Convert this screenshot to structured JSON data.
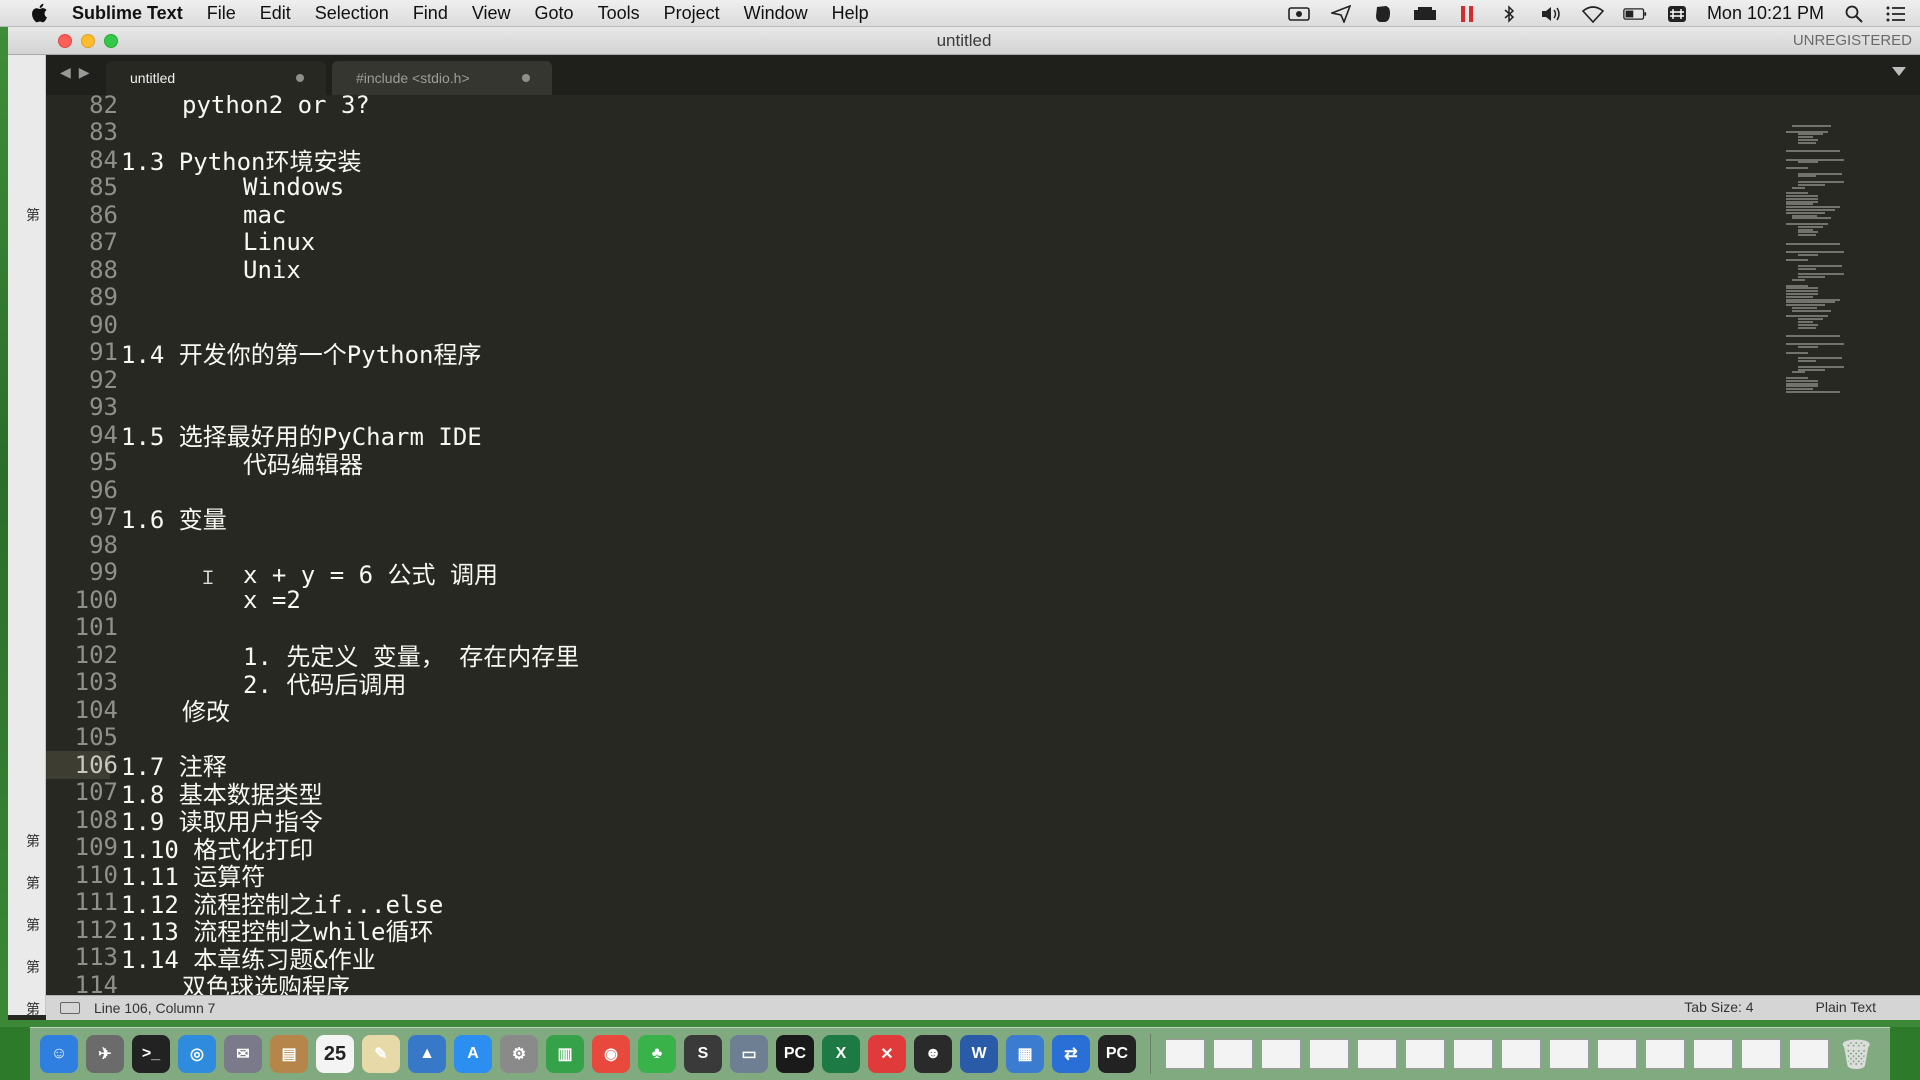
{
  "menubar": {
    "app_name": "Sublime Text",
    "items": [
      "File",
      "Edit",
      "Selection",
      "Find",
      "View",
      "Goto",
      "Tools",
      "Project",
      "Window",
      "Help"
    ],
    "clock": "Mon 10:21 PM",
    "status_icons": [
      "screen-record-icon",
      "send-icon",
      "evernote-icon",
      "drive-icon",
      "pause-icon",
      "bluetooth-icon",
      "volume-icon",
      "wifi-icon",
      "battery-icon",
      "input-method-icon",
      "spotlight-icon",
      "notification-center-icon"
    ]
  },
  "window": {
    "title": "untitled",
    "license": "UNREGISTERED"
  },
  "tabs": [
    {
      "label": "untitled",
      "active": true
    },
    {
      "label": "#include <stdio.h>",
      "active": false
    }
  ],
  "editor": {
    "current_line": 106,
    "lines": [
      {
        "n": "82",
        "indent": 2,
        "text": "python2 or 3?"
      },
      {
        "n": "83",
        "indent": 0,
        "text": ""
      },
      {
        "n": "84",
        "indent": 0,
        "text": "1.3 Python环境安装"
      },
      {
        "n": "85",
        "indent": 4,
        "text": "Windows"
      },
      {
        "n": "86",
        "indent": 4,
        "text": "mac"
      },
      {
        "n": "87",
        "indent": 4,
        "text": "Linux"
      },
      {
        "n": "88",
        "indent": 4,
        "text": "Unix"
      },
      {
        "n": "89",
        "indent": 0,
        "text": ""
      },
      {
        "n": "90",
        "indent": 0,
        "text": ""
      },
      {
        "n": "91",
        "indent": 0,
        "text": "1.4 开发你的第一个Python程序"
      },
      {
        "n": "92",
        "indent": 0,
        "text": ""
      },
      {
        "n": "93",
        "indent": 0,
        "text": ""
      },
      {
        "n": "94",
        "indent": 0,
        "text": "1.5 选择最好用的PyCharm IDE"
      },
      {
        "n": "95",
        "indent": 4,
        "text": "代码编辑器"
      },
      {
        "n": "96",
        "indent": 0,
        "text": ""
      },
      {
        "n": "97",
        "indent": 0,
        "text": "1.6 变量"
      },
      {
        "n": "98",
        "indent": 0,
        "text": ""
      },
      {
        "n": "99",
        "indent": 4,
        "text": "x + y = 6 公式 调用"
      },
      {
        "n": "100",
        "indent": 4,
        "text": "x =2"
      },
      {
        "n": "101",
        "indent": 0,
        "text": ""
      },
      {
        "n": "102",
        "indent": 4,
        "text": "1. 先定义 变量， 存在内存里"
      },
      {
        "n": "103",
        "indent": 4,
        "text": "2. 代码后调用"
      },
      {
        "n": "104",
        "indent": 2,
        "text": "修改"
      },
      {
        "n": "105",
        "indent": 0,
        "text": ""
      },
      {
        "n": "106",
        "indent": 0,
        "text": "1.7 注释"
      },
      {
        "n": "107",
        "indent": 0,
        "text": "1.8 基本数据类型"
      },
      {
        "n": "108",
        "indent": 0,
        "text": "1.9 读取用户指令"
      },
      {
        "n": "109",
        "indent": 0,
        "text": "1.10 格式化打印"
      },
      {
        "n": "110",
        "indent": 0,
        "text": "1.11 运算符"
      },
      {
        "n": "111",
        "indent": 0,
        "text": "1.12 流程控制之if...else"
      },
      {
        "n": "112",
        "indent": 0,
        "text": "1.13 流程控制之while循环"
      },
      {
        "n": "113",
        "indent": 0,
        "text": "1.14 本章练习题&作业"
      },
      {
        "n": "114",
        "indent": 2,
        "text": "双色球选购程序"
      }
    ]
  },
  "status": {
    "position": "Line 106, Column 7",
    "tab_size": "Tab Size: 4",
    "syntax": "Plain Text"
  },
  "sidebar_fragments": [
    "第",
    "第",
    "第",
    "第",
    "第",
    "第"
  ],
  "dock": {
    "calendar_day": "25",
    "apps": [
      {
        "name": "finder-icon",
        "color": "#2f7fe0",
        "glyph": "☺"
      },
      {
        "name": "launchpad-icon",
        "color": "#6b6b6b",
        "glyph": "✈"
      },
      {
        "name": "terminal-icon",
        "color": "#222222",
        "glyph": ">_"
      },
      {
        "name": "safari-icon",
        "color": "#2e8bde",
        "glyph": "◎"
      },
      {
        "name": "preview-icon",
        "color": "#7a7a8a",
        "glyph": "✉"
      },
      {
        "name": "notebook-icon",
        "color": "#b5854a",
        "glyph": "▤"
      },
      {
        "name": "calendar-icon",
        "color": "#f4f4f4",
        "glyph": ""
      },
      {
        "name": "notes-icon",
        "color": "#e8d9a8",
        "glyph": "✎"
      },
      {
        "name": "keynote-icon",
        "color": "#3778c9",
        "glyph": "▲"
      },
      {
        "name": "app-store-icon",
        "color": "#2b8ef0",
        "glyph": "A"
      },
      {
        "name": "system-preferences-icon",
        "color": "#8a8a8a",
        "glyph": "⚙"
      },
      {
        "name": "numbers-icon",
        "color": "#35a24a",
        "glyph": "▥"
      },
      {
        "name": "chrome-icon",
        "color": "#e8493c",
        "glyph": "◉"
      },
      {
        "name": "evernote-icon",
        "color": "#39b24a",
        "glyph": "♣"
      },
      {
        "name": "sublime-text-icon",
        "color": "#3a3a3a",
        "glyph": "S"
      },
      {
        "name": "scanner-icon",
        "color": "#6f7f93",
        "glyph": "▭"
      },
      {
        "name": "pycharm-icon",
        "color": "#1a1a1a",
        "glyph": "PC"
      },
      {
        "name": "excel-icon",
        "color": "#1e7a44",
        "glyph": "X"
      },
      {
        "name": "xmind-icon",
        "color": "#e03a3a",
        "glyph": "✕"
      },
      {
        "name": "qq-icon",
        "color": "#2a2a2a",
        "glyph": "☻"
      },
      {
        "name": "word-icon",
        "color": "#2a5ba8",
        "glyph": "W"
      },
      {
        "name": "screen-sharing-icon",
        "color": "#3b7bd0",
        "glyph": "▦"
      },
      {
        "name": "teamviewer-icon",
        "color": "#2a6fd6",
        "glyph": "⇄"
      },
      {
        "name": "pycharm-alt-icon",
        "color": "#222222",
        "glyph": "PC"
      }
    ],
    "trash": {
      "name": "trash-icon",
      "glyph": "🗑"
    }
  }
}
